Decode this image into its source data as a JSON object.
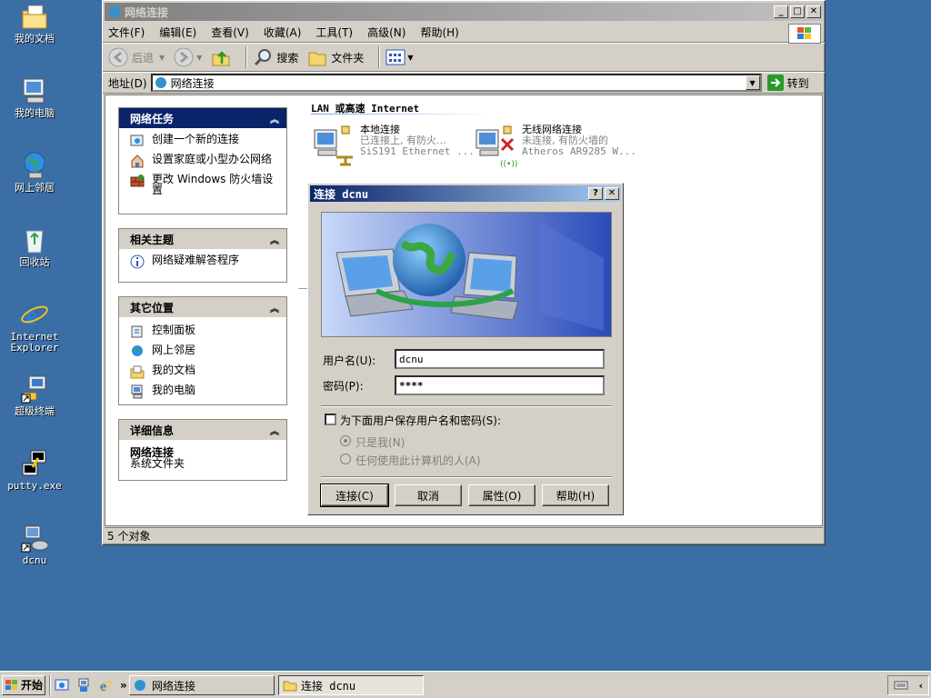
{
  "desktop": {
    "icons": [
      {
        "label": "我的文档",
        "icon": "my-documents-icon"
      },
      {
        "label": "我的电脑",
        "icon": "my-computer-icon"
      },
      {
        "label": "网上邻居",
        "icon": "network-places-icon"
      },
      {
        "label": "回收站",
        "icon": "recycle-bin-icon"
      },
      {
        "label": "Internet Explorer",
        "icon": "internet-explorer-icon"
      },
      {
        "label": "超级终端",
        "icon": "hyperterminal-icon"
      },
      {
        "label": "putty.exe",
        "icon": "putty-icon"
      },
      {
        "label": "dcnu",
        "icon": "dialup-connection-icon"
      }
    ]
  },
  "window": {
    "title": "网络连接",
    "menu": [
      "文件(F)",
      "编辑(E)",
      "查看(V)",
      "收藏(A)",
      "工具(T)",
      "高级(N)",
      "帮助(H)"
    ],
    "toolbar": {
      "back": "后退",
      "search": "搜索",
      "folders": "文件夹"
    },
    "address": {
      "label": "地址(D)",
      "value": "网络连接",
      "go": "转到"
    },
    "status": "5 个对象"
  },
  "panels": {
    "tasks": {
      "title": "网络任务",
      "items": [
        "创建一个新的连接",
        "设置家庭或小型办公网络",
        "更改 Windows 防火墙设置"
      ]
    },
    "related": {
      "title": "相关主题",
      "items": [
        "网络疑难解答程序"
      ]
    },
    "other": {
      "title": "其它位置",
      "items": [
        "控制面板",
        "网上邻居",
        "我的文档",
        "我的电脑"
      ]
    },
    "details": {
      "title": "详细信息",
      "name": "网络连接",
      "type": "系统文件夹"
    }
  },
  "content": {
    "section": "LAN 或高速 Internet",
    "connections": [
      {
        "name": "本地连接",
        "status": "已连接上, 有防火...",
        "device": "SiS191 Ethernet ..."
      },
      {
        "name": "无线网络连接",
        "status": "未连接, 有防火墙的",
        "device": "Atheros AR9285 W..."
      }
    ]
  },
  "dialog": {
    "title": "连接 dcnu",
    "user_label": "用户名(U):",
    "user_value": "dcnu",
    "pass_label": "密码(P):",
    "pass_value": "****",
    "save_label": "为下面用户保存用户名和密码(S):",
    "radio_me": "只是我(N)",
    "radio_all": "任何使用此计算机的人(A)",
    "buttons": {
      "connect": "连接(C)",
      "cancel": "取消",
      "properties": "属性(O)",
      "help": "帮助(H)"
    }
  },
  "taskbar": {
    "start": "开始",
    "chevron": "»",
    "tasks": [
      "网络连接",
      "连接 dcnu"
    ]
  },
  "colors": {
    "desktop": "#3a6ea5",
    "titlebar": "#0a246a",
    "face": "#d4d0c8"
  }
}
